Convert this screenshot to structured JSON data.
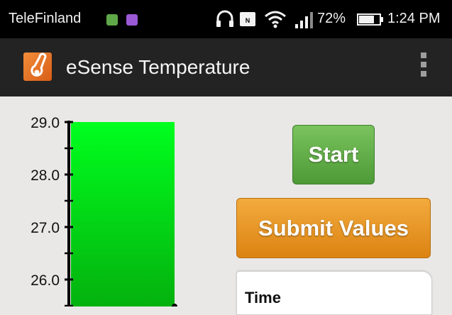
{
  "status_bar": {
    "carrier": "TeleFinland",
    "battery": "72%",
    "time": "1:24 PM",
    "icons": [
      "app-notification-icon",
      "app-notification-icon",
      "headphones-icon",
      "nfc-icon",
      "wifi-icon",
      "signal-icon",
      "battery-icon"
    ]
  },
  "app_bar": {
    "title": "eSense Temperature",
    "icon": "thermometer-icon",
    "overflow_icon": "overflow-menu-icon"
  },
  "chart_data": {
    "type": "bar",
    "values": [
      29.0
    ],
    "ylim": [
      25.4,
      29.0
    ],
    "ytick_labels": [
      "29.0",
      "28.0",
      "27.0",
      "26.0"
    ],
    "bar_color": "#00ff1e"
  },
  "buttons": {
    "start": "Start",
    "submit": "Submit Values"
  },
  "table": {
    "header": "Time"
  }
}
